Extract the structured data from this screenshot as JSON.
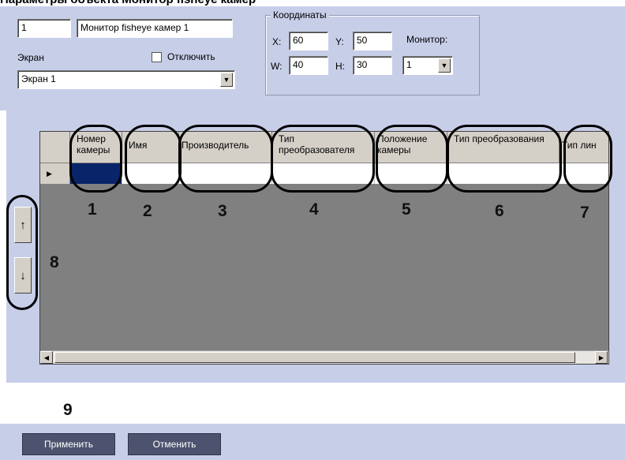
{
  "title_strip": "Параметры объекта Монитор fisheye камер",
  "monitor": {
    "id": "1",
    "name": "Монитор fisheye камер 1",
    "screen_label": "Экран",
    "screen_value": "Экран 1",
    "disable_label": "Отключить",
    "disable_checked": false
  },
  "coords": {
    "group_title": "Координаты",
    "x_label": "X:",
    "x_value": "60",
    "y_label": "Y:",
    "y_value": "50",
    "w_label": "W:",
    "w_value": "40",
    "h_label": "H:",
    "h_value": "30",
    "monitor_label": "Монитор:",
    "monitor_value": "1"
  },
  "side_buttons": {
    "up": "↑",
    "down": "↓"
  },
  "grid": {
    "row_indicator": "▶",
    "columns": [
      {
        "label": "Номер камеры"
      },
      {
        "label": "Имя"
      },
      {
        "label": "Производитель"
      },
      {
        "label": "Тип преобразователя"
      },
      {
        "label": "Положение камеры"
      },
      {
        "label": "Тип преобразования"
      },
      {
        "label": "Тип лин"
      }
    ],
    "scroll_left": "◀",
    "scroll_right": "▶"
  },
  "callouts": [
    "1",
    "2",
    "3",
    "4",
    "5",
    "6",
    "7",
    "8",
    "9"
  ],
  "buttons": {
    "apply": "Применить",
    "cancel": "Отменить"
  },
  "colors": {
    "panel_bg": "#c7cee8",
    "grid_bg": "#808080",
    "selected_cell": "#0a246a",
    "action_button": "#4d536e"
  }
}
